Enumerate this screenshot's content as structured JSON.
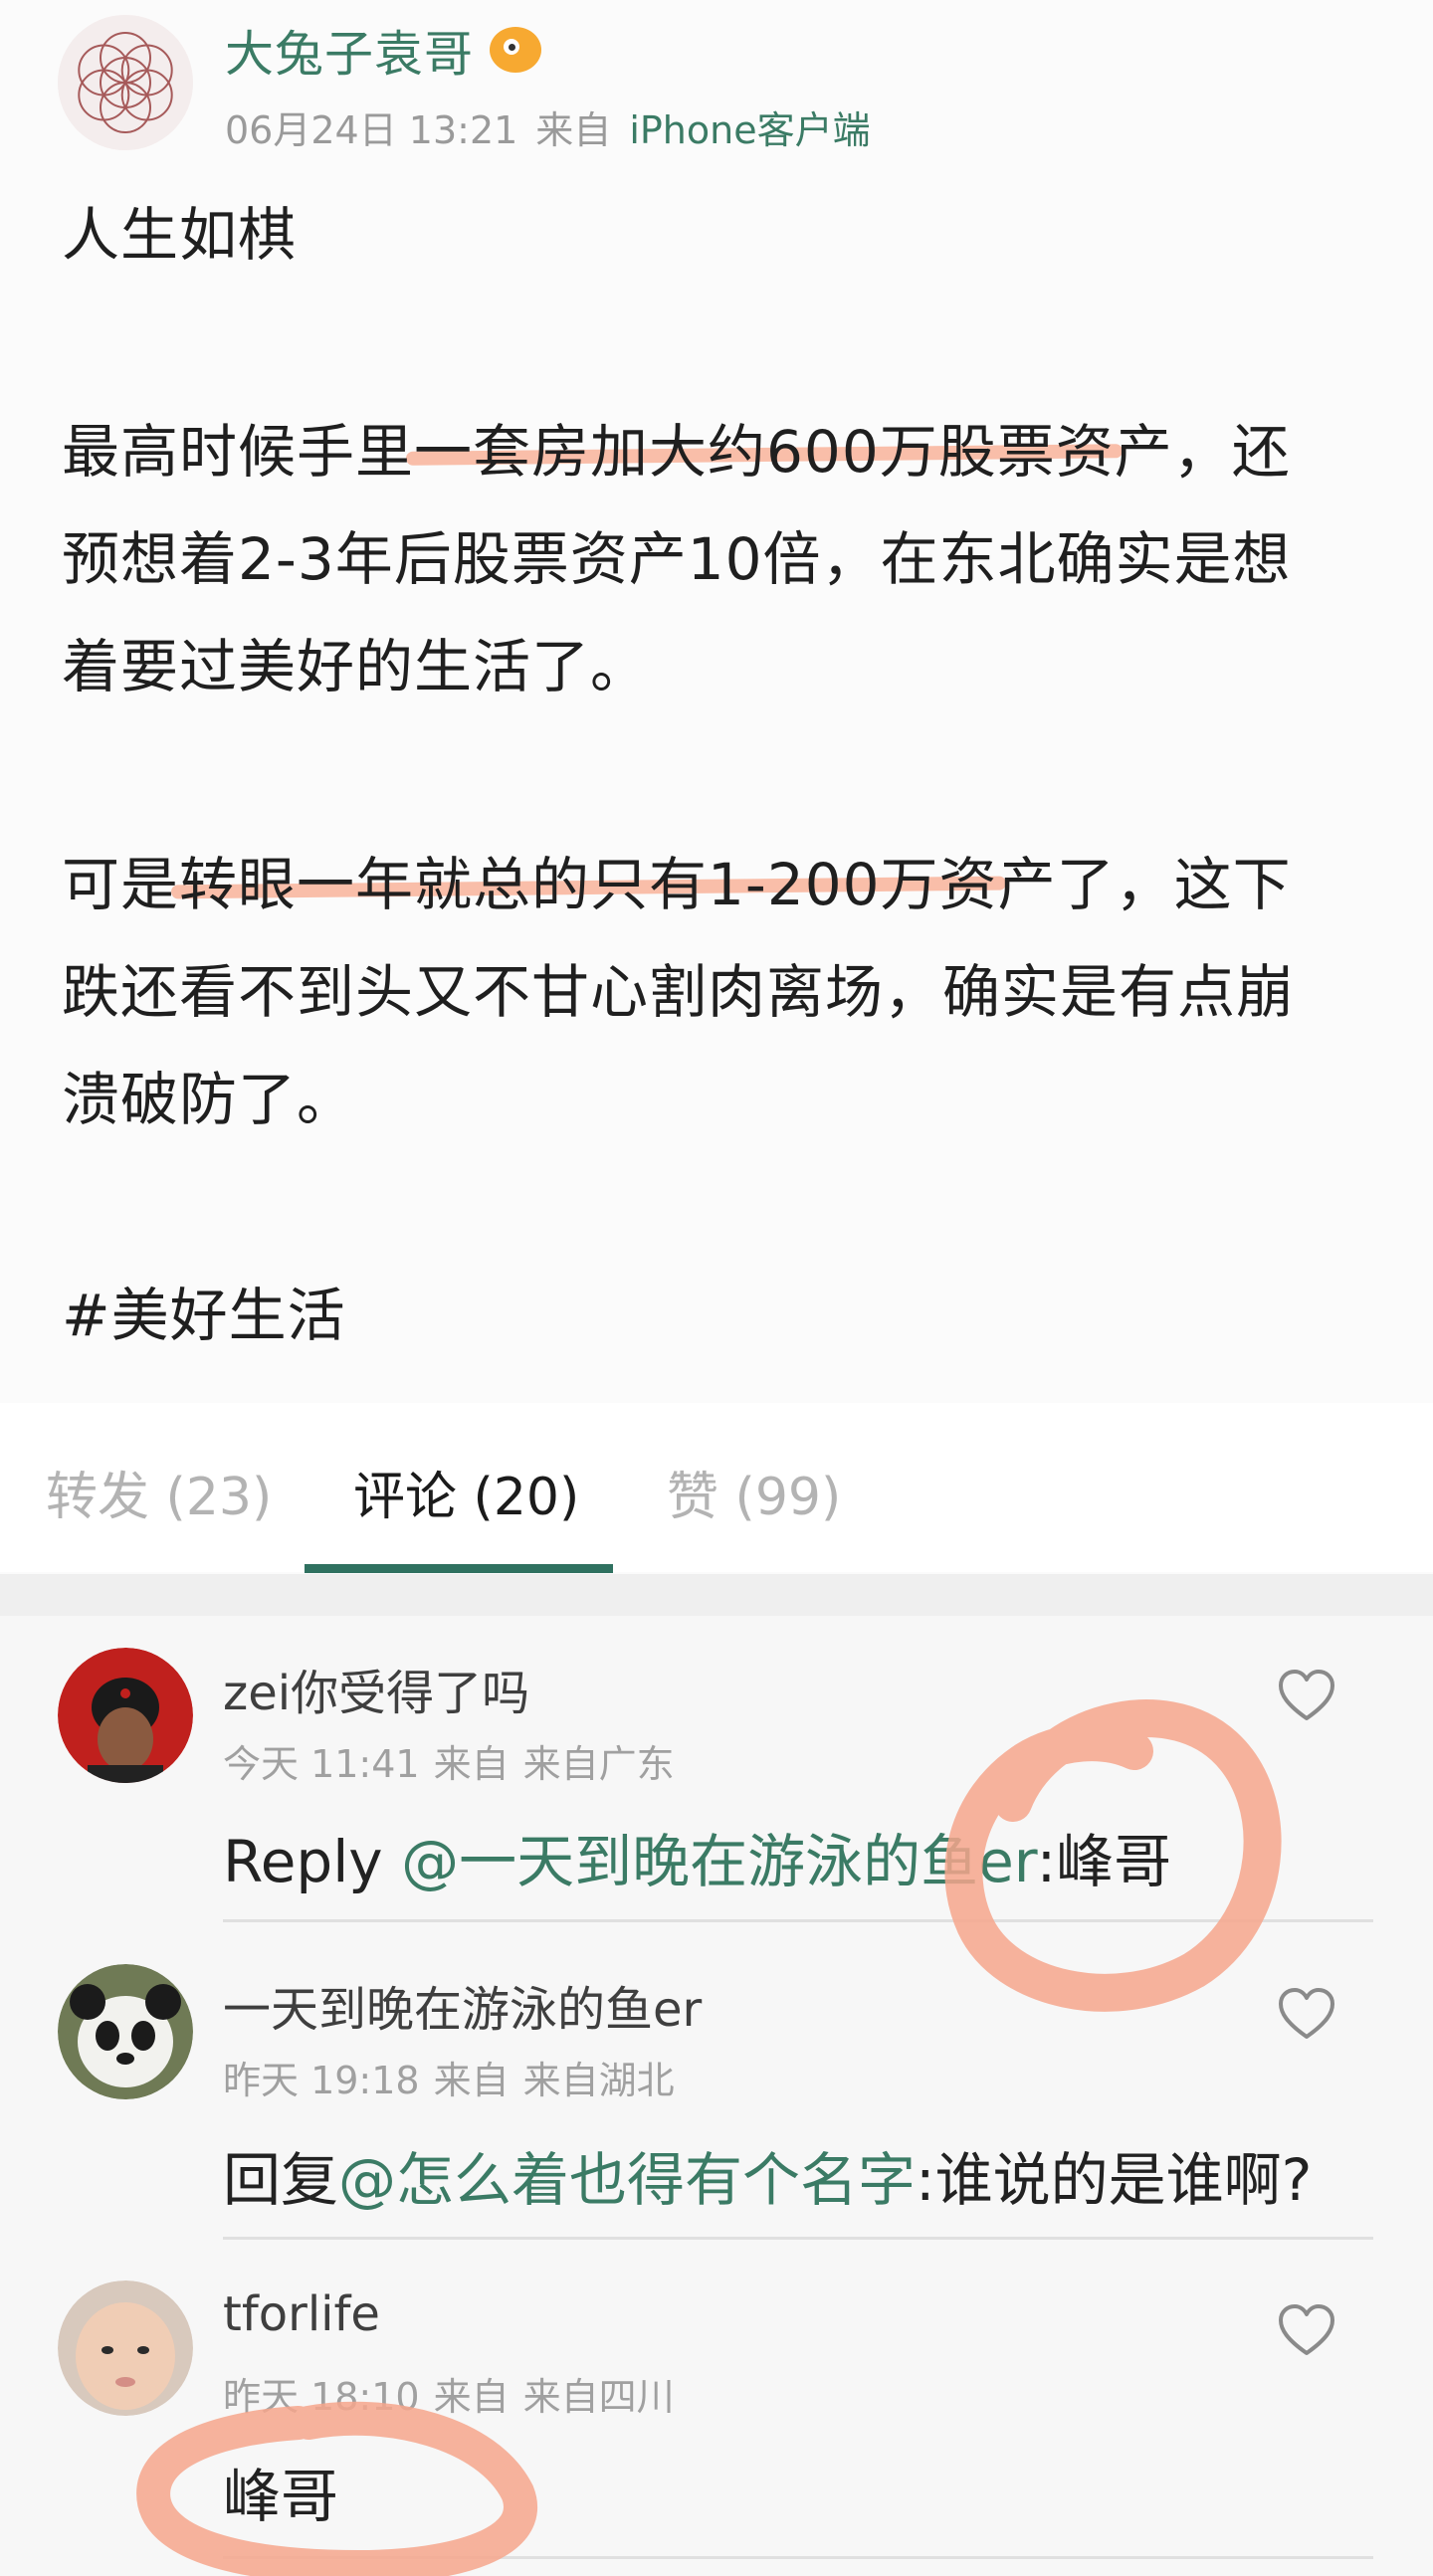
{
  "post": {
    "author": "大兔子袁哥",
    "author_badge_icon": "puffer-fish-badge-icon",
    "time": "06月24日 13:21",
    "from_label": "来自",
    "source": "iPhone客户端",
    "p1": "人生如棋",
    "p2_l1_pre": "最高时候手里",
    "p2_l1_hl": "一套房加大约600万股票资",
    "p2_l1_post": "产，还",
    "p2_l2": "预想着2-3年后股票资产10倍，在东北确实是想",
    "p2_l3": "着要过美好的生活了。",
    "p3_l1_pre": "可是",
    "p3_l1_hl": "转眼一年就总的只有1-200万资",
    "p3_l1_post": "产了，这下",
    "p3_l2": "跌还看不到头又不甘心割肉离场，确实是有点崩",
    "p3_l3": "溃破防了。",
    "hashtag": "#美好生活"
  },
  "tabs": {
    "repost": "转发 (23)",
    "comments": "评论 (20)",
    "likes": "赞 (99)"
  },
  "comments": [
    {
      "name": "zei你受得了吗",
      "time": "今天 11:41",
      "from_label": "来自",
      "location": "来自广东",
      "text_prefix": "Reply ",
      "mention": "@一天到晚在游泳的鱼er",
      "text_suffix": ":峰哥"
    },
    {
      "name": "一天到晚在游泳的鱼er",
      "time": "昨天 19:18",
      "from_label": "来自",
      "location": "来自湖北",
      "text_prefix": "回复",
      "mention": "@怎么着也得有个名字",
      "text_suffix": ":谁说的是谁啊?"
    },
    {
      "name": "tforlife",
      "time": "昨天 18:10",
      "from_label": "来自",
      "location": "来自四川",
      "text_prefix": "峰哥",
      "mention": "",
      "text_suffix": ""
    }
  ],
  "colors": {
    "accent": "#3b7b65",
    "highlight": "#f8b39a",
    "scribble": "#f6a68c"
  }
}
